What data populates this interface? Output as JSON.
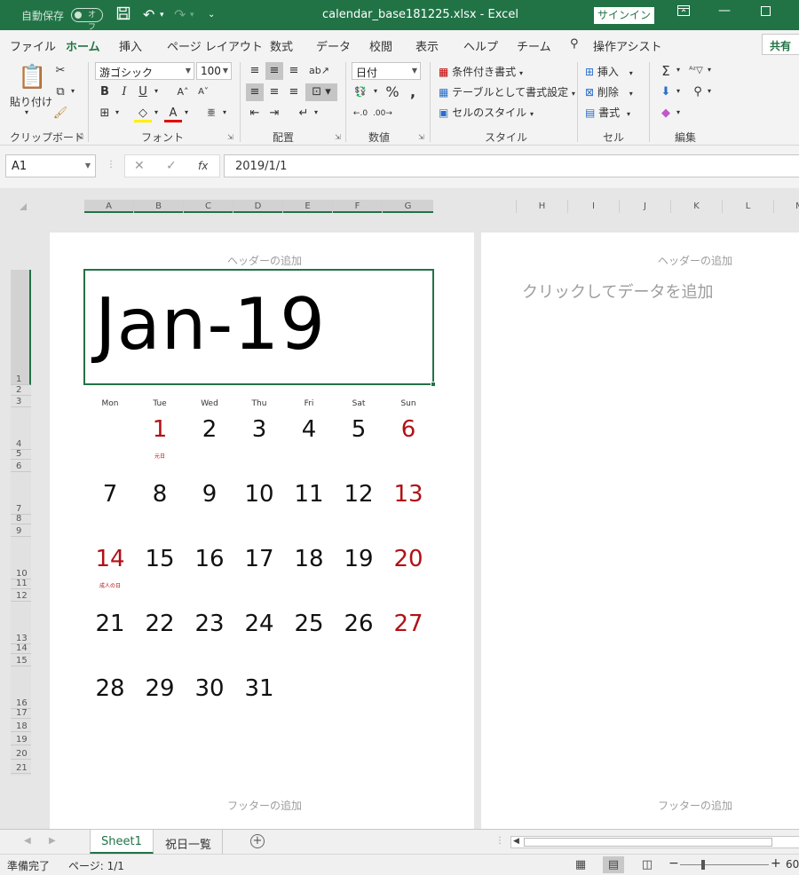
{
  "titlebar": {
    "autosave_label": "自動保存",
    "autosave_state": "オフ",
    "title": "calendar_base181225.xlsx  -  Excel",
    "signin": "サインイン"
  },
  "tabs": [
    "ファイル",
    "ホーム",
    "挿入",
    "ページ レイアウト",
    "数式",
    "データ",
    "校閲",
    "表示",
    "ヘルプ",
    "チーム"
  ],
  "tell_me": "操作アシスト",
  "share": "共有",
  "ribbon": {
    "clipboard": {
      "label": "クリップボード",
      "paste": "貼り付け"
    },
    "font": {
      "label": "フォント",
      "name": "游ゴシック",
      "size": "100"
    },
    "alignment": {
      "label": "配置"
    },
    "number": {
      "label": "数値",
      "format": "日付"
    },
    "styles": {
      "label": "スタイル",
      "conditional": "条件付き書式",
      "as_table": "テーブルとして書式設定",
      "cell_styles": "セルのスタイル"
    },
    "cells": {
      "label": "セル",
      "insert": "挿入",
      "delete": "削除",
      "format": "書式"
    },
    "editing": {
      "label": "編集"
    }
  },
  "formula_bar": {
    "name_box": "A1",
    "fx": "fx",
    "value": "2019/1/1"
  },
  "columns_left": [
    "A",
    "B",
    "C",
    "D",
    "E",
    "F",
    "G"
  ],
  "columns_right": [
    "H",
    "I",
    "J",
    "K",
    "L",
    "M"
  ],
  "rows": [
    "1",
    "2",
    "3",
    "4",
    "5",
    "6",
    "7",
    "8",
    "9",
    "10",
    "11",
    "12",
    "13",
    "14",
    "15",
    "16",
    "17",
    "18",
    "19",
    "20",
    "21"
  ],
  "page1": {
    "header": "ヘッダーの追加",
    "footer": "フッターの追加",
    "month": "Jan-19",
    "weekdays": [
      "Mon",
      "Tue",
      "Wed",
      "Thu",
      "Fri",
      "Sat",
      "Sun"
    ],
    "weeks": [
      [
        "",
        "1",
        "2",
        "3",
        "4",
        "5",
        "6"
      ],
      [
        "7",
        "8",
        "9",
        "10",
        "11",
        "12",
        "13"
      ],
      [
        "14",
        "15",
        "16",
        "17",
        "18",
        "19",
        "20"
      ],
      [
        "21",
        "22",
        "23",
        "24",
        "25",
        "26",
        "27"
      ],
      [
        "28",
        "29",
        "30",
        "31",
        "",
        "",
        ""
      ]
    ],
    "holiday_1": "元日",
    "holiday_14": "成人の日",
    "colors": {
      "red": "#b01116"
    }
  },
  "page2": {
    "header": "ヘッダーの追加",
    "footer": "フッターの追加",
    "placeholder": "クリックしてデータを追加"
  },
  "sheets": [
    "Sheet1",
    "祝日一覧"
  ],
  "status": {
    "ready": "準備完了",
    "page": "ページ: 1/1",
    "zoom": "60"
  },
  "colors": {
    "accent": "#217346"
  }
}
